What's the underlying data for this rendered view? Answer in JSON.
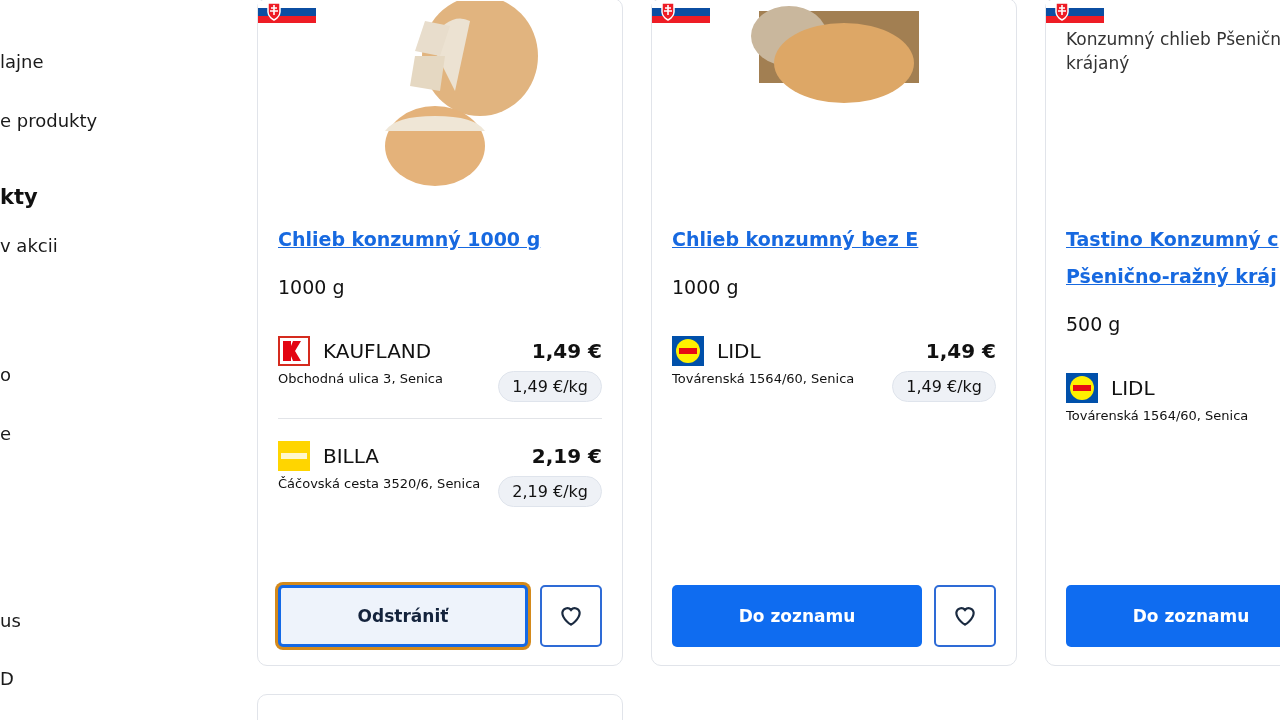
{
  "sidebar": {
    "items": [
      {
        "kind": "link",
        "label": "lajne"
      },
      {
        "kind": "link",
        "label": "e produkty"
      },
      {
        "kind": "heading",
        "label": "kty"
      },
      {
        "kind": "link",
        "label": "v akcii"
      },
      {
        "kind": "link",
        "label": "o"
      },
      {
        "kind": "link",
        "label": "e"
      },
      {
        "kind": "link",
        "label": "us"
      },
      {
        "kind": "link",
        "label": "D"
      }
    ]
  },
  "products": [
    {
      "title_lines": [
        "Chlieb konzumný 1000 g"
      ],
      "weight": "1000 g",
      "stores": [
        {
          "kind": "kaufland",
          "name": "KAUFLAND",
          "address": "Obchodná ulica 3, Senica",
          "price": "1,49 €",
          "unit_price": "1,49 €/kg"
        },
        {
          "kind": "billa",
          "name": "BILLA",
          "address": "Čáčovská cesta 3520/6, Senica",
          "price": "2,19 €",
          "unit_price": "2,19 €/kg"
        }
      ],
      "button": {
        "label": "Odstrániť",
        "in_list": true,
        "focused": true
      }
    },
    {
      "title_lines": [
        "Chlieb konzumný bez E"
      ],
      "weight": "1000 g",
      "stores": [
        {
          "kind": "lidl",
          "name": "LIDL",
          "address": "Továrenská 1564/60, Senica",
          "price": "1,49 €",
          "unit_price": "1,49 €/kg"
        }
      ],
      "button": {
        "label": "Do zoznamu",
        "in_list": false,
        "focused": false
      }
    },
    {
      "alt_lines": [
        "Konzumný chlieb Pšeničn",
        "krájaný"
      ],
      "title_lines": [
        "Tastino Konzumný c",
        "Pšenično-ražný kráj"
      ],
      "weight": "500 g",
      "stores": [
        {
          "kind": "lidl",
          "name": "LIDL",
          "address": "Továrenská 1564/60, Senica"
        }
      ],
      "button": {
        "label": "Do zoznamu",
        "in_list": false,
        "focused": false
      }
    }
  ]
}
